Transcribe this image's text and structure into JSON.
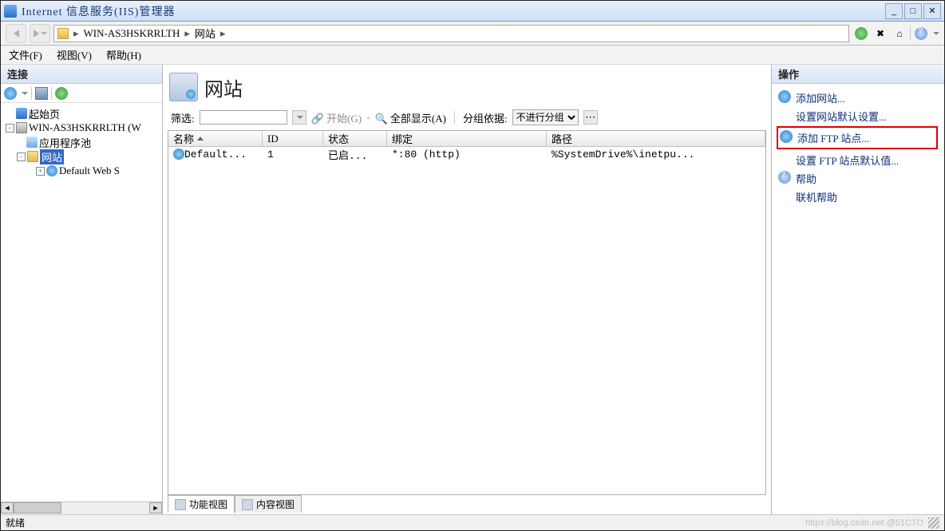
{
  "window": {
    "title": "Internet 信息服务(IIS)管理器"
  },
  "breadcrumb": {
    "server": "WIN-AS3HSKRRLTH",
    "node": "网站"
  },
  "menubar": {
    "file": "文件(F)",
    "view": "视图(V)",
    "help": "帮助(H)"
  },
  "left_panel": {
    "title": "连接"
  },
  "tree": {
    "start": "起始页",
    "server": "WIN-AS3HSKRRLTH (W",
    "apppool": "应用程序池",
    "sites": "网站",
    "defaultsite": "Default Web S"
  },
  "center": {
    "title": "网站",
    "filter_label": "筛选:",
    "filter_value": "",
    "start_btn": "开始(G)",
    "showall": "全部显示(A)",
    "groupby_label": "分组依据:",
    "groupby_value": "不进行分组",
    "columns": {
      "name": "名称",
      "id": "ID",
      "state": "状态",
      "bind": "绑定",
      "path": "路径"
    },
    "rows": [
      {
        "name": "Default...",
        "id": "1",
        "state": "已启...",
        "bind": "*:80 (http)",
        "path": "%SystemDrive%\\inetpu..."
      }
    ]
  },
  "tabs": {
    "features": "功能视图",
    "content": "内容视图"
  },
  "right_panel": {
    "title": "操作"
  },
  "actions": {
    "add_site": "添加网站...",
    "site_defaults": "设置网站默认设置...",
    "add_ftp": "添加 FTP 站点...",
    "ftp_defaults": "设置 FTP 站点默认值...",
    "help": "帮助",
    "online_help": "联机帮助"
  },
  "status": {
    "ready": "就绪"
  },
  "watermark": "https://blog.csdn.net  @51CTO"
}
